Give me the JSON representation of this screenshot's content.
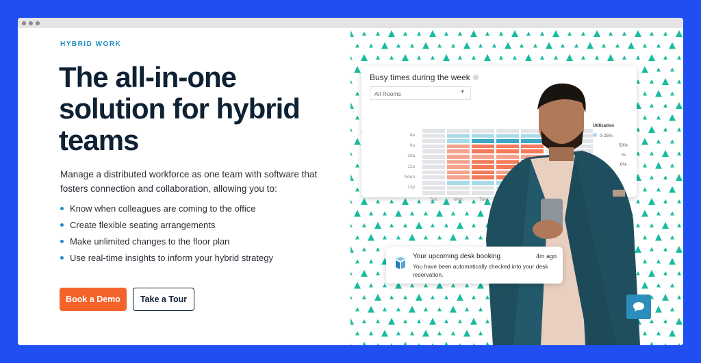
{
  "hero": {
    "eyebrow": "HYBRID WORK",
    "title": "The all-in-one solution for hybrid teams",
    "lead": "Manage a distributed workforce as one team with software that fosters connection and collaboration, allowing you to:",
    "bullets": [
      "Know when colleagues are coming to the office",
      "Create flexible seating arrangements",
      "Make unlimited changes to the floor plan",
      "Use real-time insights to inform your hybrid strategy"
    ],
    "demo_label": "Book a Demo",
    "tour_label": "Take a Tour"
  },
  "widget": {
    "title": "Busy times during the week",
    "select": "All Rooms",
    "rows": [
      "8a",
      "9a",
      "10a",
      "11a",
      "Noon",
      "12p"
    ],
    "cols": [
      "Sun",
      "Mon",
      "Tue"
    ],
    "legend_title": "Utilization",
    "legend": [
      "0-25%",
      "50%",
      "%",
      "0%"
    ],
    "levels": [
      [
        0,
        0,
        0,
        0,
        0,
        0,
        0
      ],
      [
        0,
        1,
        1,
        1,
        1,
        0,
        0
      ],
      [
        0,
        1,
        2,
        2,
        2,
        0,
        0
      ],
      [
        0,
        3,
        4,
        4,
        4,
        0,
        0
      ],
      [
        0,
        3,
        4,
        4,
        4,
        0,
        0
      ],
      [
        0,
        3,
        3,
        3,
        3,
        0,
        0
      ],
      [
        0,
        3,
        4,
        4,
        4,
        0,
        0
      ],
      [
        0,
        3,
        4,
        4,
        4,
        0,
        0
      ],
      [
        0,
        3,
        4,
        3,
        3,
        0,
        0
      ],
      [
        0,
        3,
        4,
        4,
        3,
        0,
        0
      ],
      [
        0,
        1,
        1,
        1,
        1,
        0,
        0
      ],
      [
        0,
        0,
        0,
        0,
        0,
        0,
        0
      ],
      [
        0,
        0,
        0,
        0,
        0,
        0,
        0
      ]
    ],
    "level_colors": [
      "#e2e4e8",
      "#a8dbe6",
      "#3fa7c8",
      "#f4a48e",
      "#f47a5a"
    ]
  },
  "notification": {
    "title": "Your upcoming desk booking",
    "time": "4m ago",
    "message": "You have been automatically checked into your desk reservation."
  },
  "colors": {
    "accent": "#f4632b",
    "brand": "#1d8fc4",
    "triangle": "#19bba0"
  }
}
